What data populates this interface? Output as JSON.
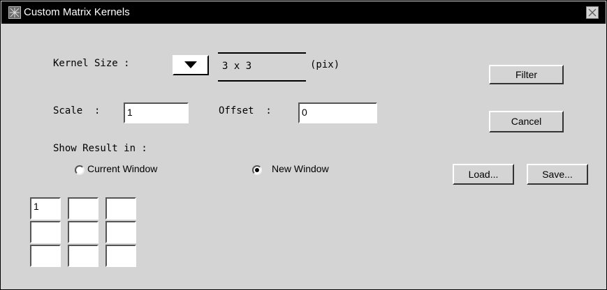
{
  "window": {
    "title": "Custom Matrix Kernels"
  },
  "kernel_size": {
    "label": "Kernel Size :",
    "value": "3 x 3",
    "unit": "(pix)"
  },
  "scale": {
    "label": "Scale  :",
    "value": "1"
  },
  "offset": {
    "label": "Offset  :",
    "value": "0"
  },
  "show_result": {
    "label": "Show Result in :",
    "options": [
      {
        "label": "Current Window",
        "selected": false
      },
      {
        "label": "New Window",
        "selected": true
      }
    ]
  },
  "buttons": {
    "filter": "Filter",
    "cancel": "Cancel",
    "load": "Load...",
    "save": "Save..."
  },
  "matrix": [
    [
      "1",
      "",
      ""
    ],
    [
      "",
      "",
      ""
    ],
    [
      "",
      "",
      ""
    ]
  ]
}
